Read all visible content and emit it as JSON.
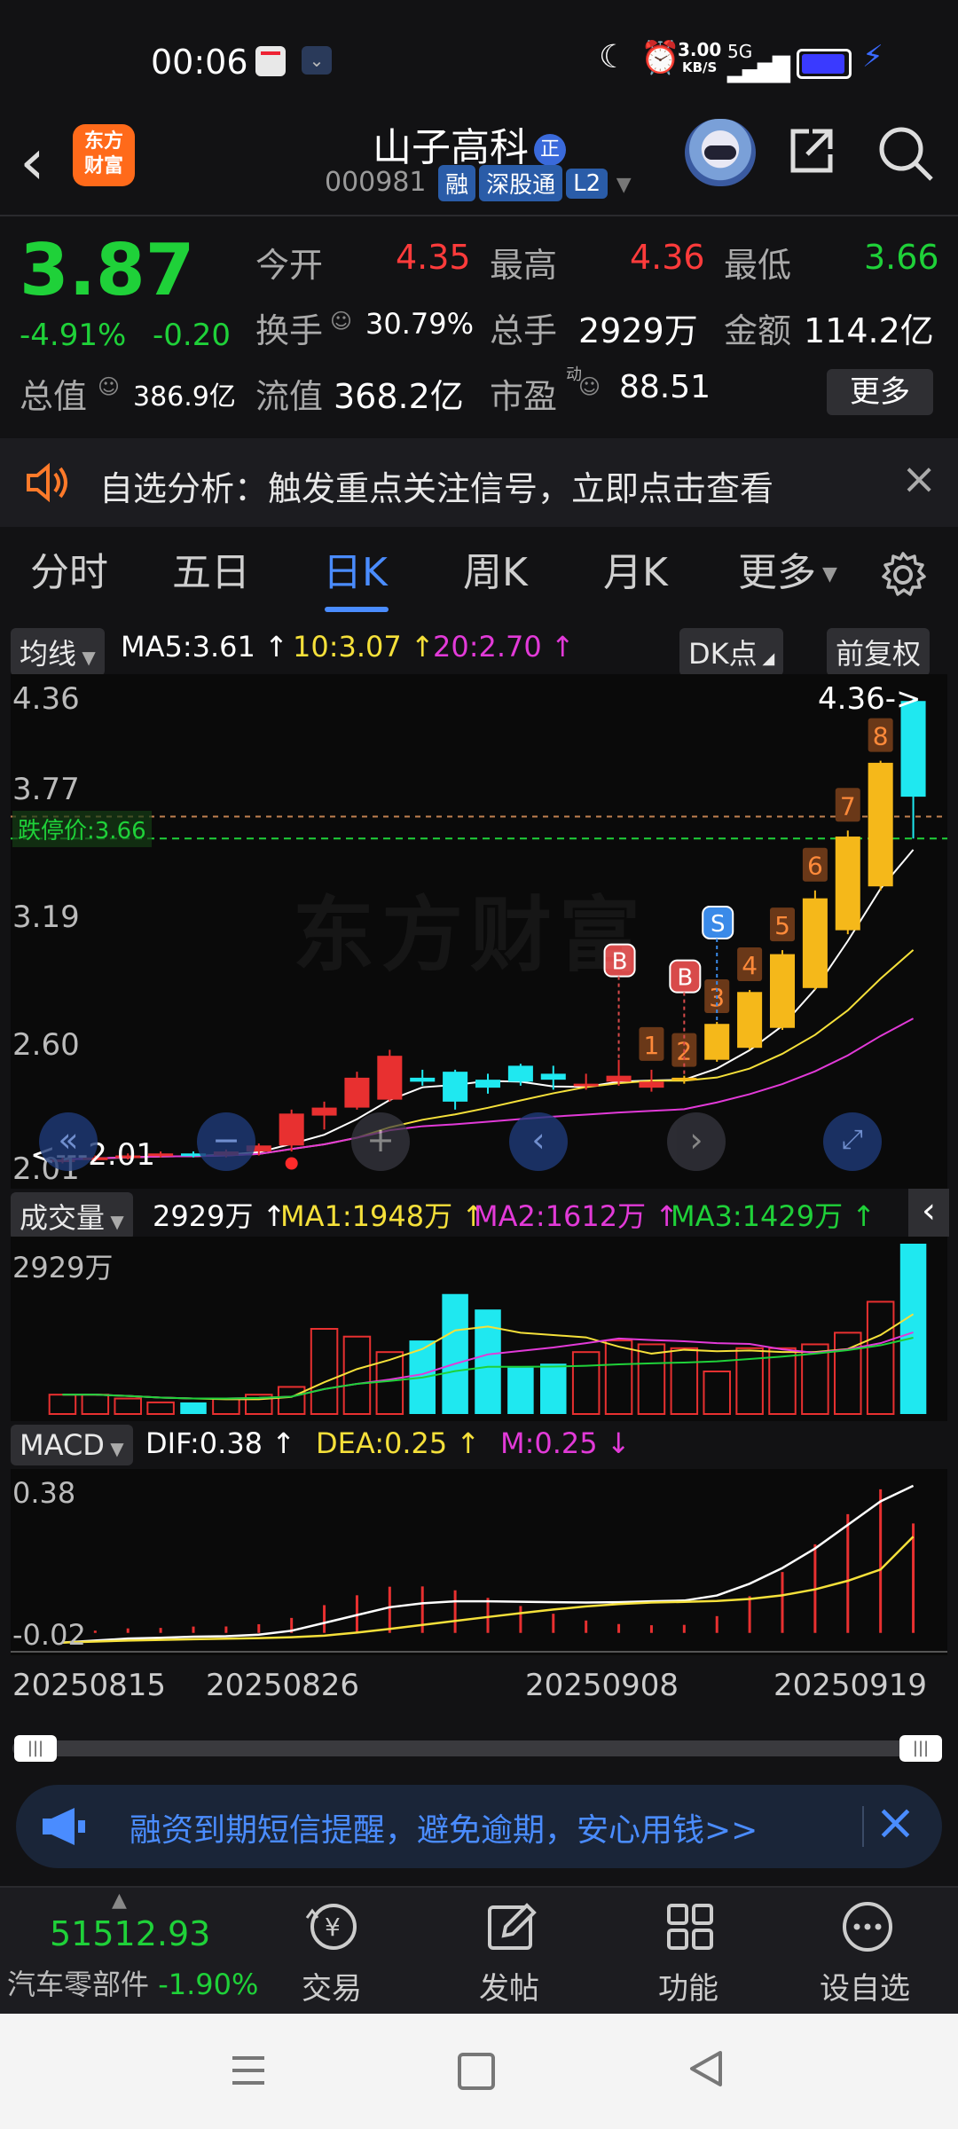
{
  "status_bar": {
    "time": "00:06",
    "net_speed": "3.00",
    "net_unit": "KB/S",
    "signal": "5G"
  },
  "header": {
    "stock_name": "山子高科",
    "stock_badge": "正",
    "stock_code": "000981",
    "tags": [
      "融",
      "深股通",
      "L2"
    ],
    "app_logo": "东方\n财富"
  },
  "quote": {
    "price": "3.87",
    "change_pct": "-4.91%",
    "change": "-0.20",
    "rows": [
      [
        {
          "label": "今开",
          "value": "4.35",
          "color": "red"
        },
        {
          "label": "最高",
          "value": "4.36",
          "color": "red"
        },
        {
          "label": "最低",
          "value": "3.66",
          "color": "green"
        }
      ],
      [
        {
          "label": "换手",
          "value": "30.79%",
          "color": "white"
        },
        {
          "label": "总手",
          "value": "2929万",
          "color": "white"
        },
        {
          "label": "金额",
          "value": "114.2亿",
          "color": "white"
        }
      ],
      [
        {
          "label": "总值",
          "value": "386.9亿",
          "color": "white"
        },
        {
          "label": "流值",
          "value": "368.2亿",
          "color": "white"
        },
        {
          "label": "市盈",
          "value": "88.51",
          "color": "white",
          "sup": "动"
        }
      ]
    ],
    "more_label": "更多"
  },
  "notice": {
    "text": "自选分析：触发重点关注信号，立即点击查看"
  },
  "tabs": [
    "分时",
    "五日",
    "日K",
    "周K",
    "月K",
    "更多"
  ],
  "active_tab": "日K",
  "kline": {
    "ma_selector": "均线",
    "ma5": "MA5:3.61",
    "ma10": "10:3.07",
    "ma20": "20:2.70",
    "dk_label": "DK点",
    "fq_label": "前复权",
    "y_labels": [
      "4.36",
      "3.77",
      "3.19",
      "2.60",
      "2.01"
    ],
    "limit_down": "跌停价:3.66",
    "high_marker": "4.36->",
    "low_marker": "<---2.01",
    "watermark": "东方财富",
    "signals": [
      "B",
      "B",
      "S"
    ],
    "counts": [
      "1",
      "2",
      "3",
      "4",
      "5",
      "6",
      "7",
      "8"
    ]
  },
  "volume": {
    "selector": "成交量",
    "value": "2929万",
    "ma1": "MA1:1948万",
    "ma2": "MA2:1612万",
    "ma3": "MA3:1429万",
    "y_label": "2929万"
  },
  "macd": {
    "selector": "MACD",
    "dif": "DIF:0.38",
    "dea": "DEA:0.25",
    "m": "M:0.25",
    "y_top": "0.38",
    "y_bottom": "-0.02"
  },
  "dates": [
    "20250815",
    "20250826",
    "20250908",
    "20250919"
  ],
  "ad": {
    "text": "融资到期短信提醒，避免逾期，安心用钱>>"
  },
  "bottom": {
    "index_value": "51512.93",
    "sector": "汽车零部件",
    "sector_change": "-1.90%",
    "nav": [
      "交易",
      "发帖",
      "功能",
      "设自选"
    ]
  },
  "chart_data": {
    "type": "candlestick",
    "x": [
      "20250815",
      "20250818",
      "20250819",
      "20250820",
      "20250821",
      "20250822",
      "20250825",
      "20250826",
      "20250827",
      "20250828",
      "20250829",
      "20250901",
      "20250902",
      "20250903",
      "20250904",
      "20250905",
      "20250908",
      "20250909",
      "20250910",
      "20250911",
      "20250912",
      "20250915",
      "20250916",
      "20250917",
      "20250918",
      "20250919",
      "20250922"
    ],
    "open": [
      2.04,
      2.05,
      2.06,
      2.07,
      2.08,
      2.07,
      2.09,
      2.12,
      2.27,
      2.31,
      2.35,
      2.46,
      2.49,
      2.45,
      2.52,
      2.48,
      2.42,
      2.44,
      2.41,
      2.45,
      2.55,
      2.61,
      2.71,
      2.91,
      3.2,
      3.42,
      4.35
    ],
    "close": [
      2.05,
      2.06,
      2.07,
      2.08,
      2.07,
      2.09,
      2.12,
      2.28,
      2.31,
      2.46,
      2.57,
      2.44,
      2.34,
      2.41,
      2.44,
      2.45,
      2.43,
      2.47,
      2.44,
      2.46,
      2.73,
      2.89,
      3.08,
      3.36,
      3.67,
      4.04,
      3.87
    ],
    "high": [
      2.06,
      2.07,
      2.08,
      2.09,
      2.09,
      2.1,
      2.13,
      2.3,
      2.34,
      2.49,
      2.6,
      2.5,
      2.5,
      2.48,
      2.53,
      2.52,
      2.48,
      2.55,
      2.5,
      2.47,
      2.74,
      2.9,
      3.1,
      3.4,
      3.7,
      4.05,
      4.36
    ],
    "low": [
      2.03,
      2.04,
      2.05,
      2.06,
      2.06,
      2.06,
      2.07,
      2.09,
      2.2,
      2.3,
      2.34,
      2.42,
      2.3,
      2.38,
      2.42,
      2.4,
      2.4,
      2.42,
      2.39,
      2.43,
      2.54,
      2.6,
      2.7,
      2.9,
      3.18,
      3.4,
      3.66
    ],
    "ylim": [
      2.01,
      4.36
    ]
  }
}
